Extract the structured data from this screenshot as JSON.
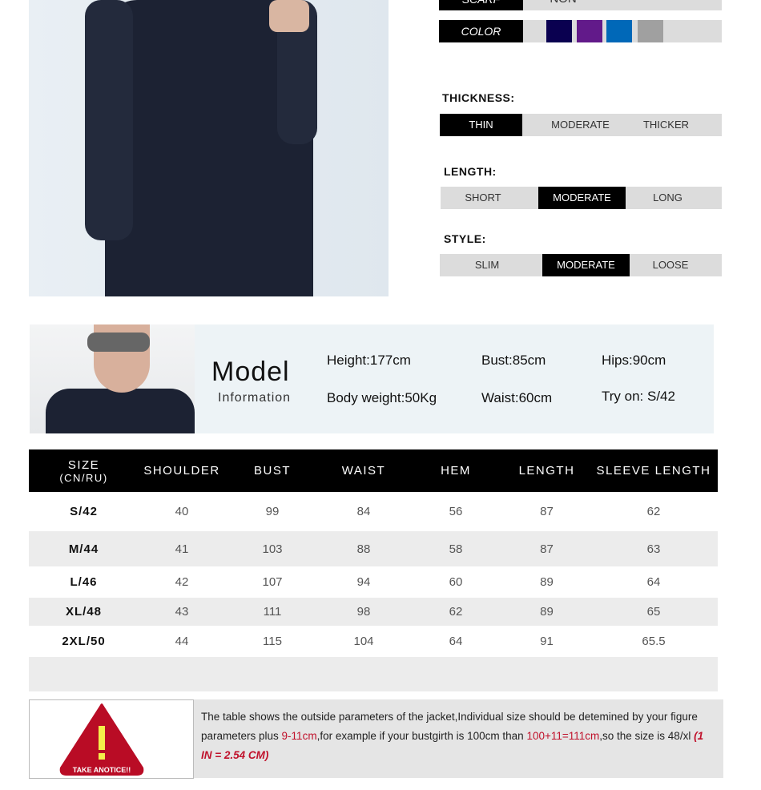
{
  "options": {
    "scarf": {
      "label": "SCARF",
      "value": "NON"
    },
    "color": {
      "label": "COLOR",
      "swatches": [
        "#0a0050",
        "#621a8a",
        "#0068b8",
        "#a0a0a0"
      ]
    },
    "thickness": {
      "label": "THICKNESS:",
      "options": [
        "THIN",
        "MODERATE",
        "THICKER"
      ],
      "selected": "THIN"
    },
    "length": {
      "label": "LENGTH:",
      "options": [
        "SHORT",
        "MODERATE",
        "LONG"
      ],
      "selected": "MODERATE"
    },
    "style": {
      "label": "STYLE:",
      "options": [
        "SLIM",
        "MODERATE",
        "LOOSE"
      ],
      "selected": "MODERATE"
    }
  },
  "model": {
    "title": "Model",
    "subtitle": "Information",
    "height": "Height:177cm",
    "bust": "Bust:85cm",
    "hips": "Hips:90cm",
    "weight": "Body weight:50Kg",
    "waist": "Waist:60cm",
    "try_on": "Try on:  S/42"
  },
  "size_table": {
    "headers": [
      "SIZE",
      "(CN/RU)",
      "SHOULDER",
      "BUST",
      "WAIST",
      "HEM",
      "LENGTH",
      "SLEEVE LENGTH"
    ],
    "rows": [
      [
        "S/42",
        "40",
        "99",
        "84",
        "56",
        "87",
        "62"
      ],
      [
        "M/44",
        "41",
        "103",
        "88",
        "58",
        "87",
        "63"
      ],
      [
        "L/46",
        "42",
        "107",
        "94",
        "60",
        "89",
        "64"
      ],
      [
        "XL/48",
        "43",
        "111",
        "98",
        "62",
        "89",
        "65"
      ],
      [
        "2XL/50",
        "44",
        "115",
        "104",
        "64",
        "91",
        "65.5"
      ]
    ]
  },
  "notice": {
    "badge": "TAKE ANOTICE!!",
    "t1": "The table shows the outside parameters of the jacket,Individual size should be detemined by your figure parameters plus ",
    "r1": "9-11cm",
    "t2": ",for example if your bustgirth is 100cm than ",
    "r2": "100+11=111cm",
    "t3": ",so the size is 48/xl  ",
    "r3": "(1 IN = 2.54 CM)"
  }
}
